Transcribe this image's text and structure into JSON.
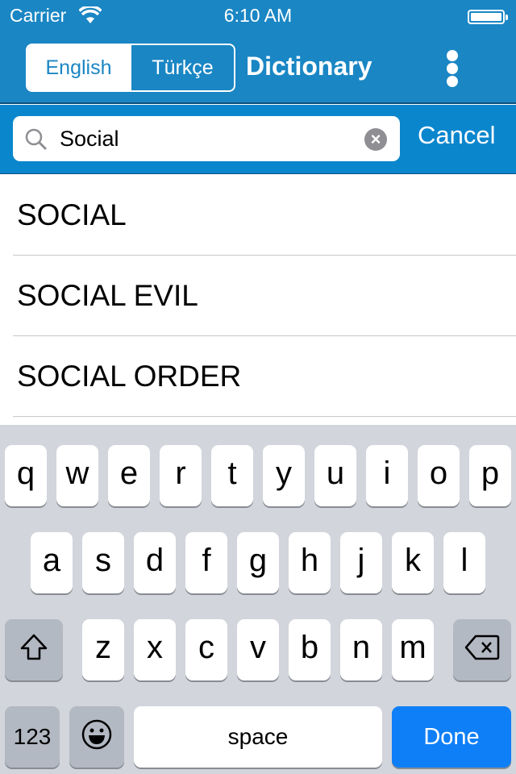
{
  "status_bar": {
    "carrier": "Carrier",
    "time": "6:10 AM",
    "wifi_icon": "wifi-icon",
    "battery_level": 1.0
  },
  "nav": {
    "segments": [
      "English",
      "Türkçe"
    ],
    "selected_segment": "English",
    "title": "Dictionary",
    "menu_icon": "more-vertical-icon"
  },
  "search": {
    "value": "Social",
    "placeholder": "",
    "cancel_label": "Cancel"
  },
  "results": [
    "SOCIAL",
    "SOCIAL EVIL",
    "SOCIAL ORDER"
  ],
  "keyboard": {
    "row1": [
      "q",
      "w",
      "e",
      "r",
      "t",
      "y",
      "u",
      "i",
      "o",
      "p"
    ],
    "row2": [
      "a",
      "s",
      "d",
      "f",
      "g",
      "h",
      "j",
      "k",
      "l"
    ],
    "row3": [
      "z",
      "x",
      "c",
      "v",
      "b",
      "n",
      "m"
    ],
    "numbers_label": "123",
    "space_label": "space",
    "done_label": "Done"
  },
  "colors": {
    "nav": "#1a86c4",
    "search_bar": "#0a86cd",
    "done": "#0f7ff8",
    "keyboard": "#d2d5db"
  }
}
